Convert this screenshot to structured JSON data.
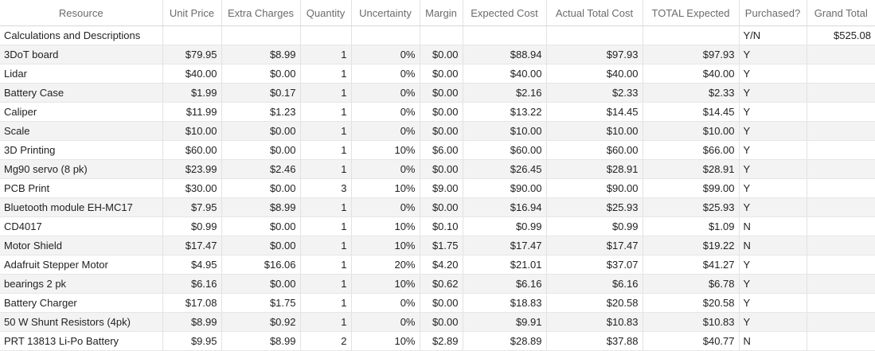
{
  "table": {
    "headers": [
      "Resource",
      "Unit Price",
      "Extra Charges",
      "Quantity",
      "Uncertainty",
      "Margin",
      "Expected Cost",
      "Actual Total Cost",
      "TOTAL Expected",
      "Purchased?",
      "Grand Total"
    ],
    "rows": [
      [
        "Calculations and Descriptions",
        "",
        "",
        "",
        "",
        "",
        "",
        "",
        "",
        "Y/N",
        "$525.08"
      ],
      [
        "3DoT board",
        "$79.95",
        "$8.99",
        "1",
        "0%",
        "$0.00",
        "$88.94",
        "$97.93",
        "$97.93",
        "Y",
        ""
      ],
      [
        "Lidar",
        "$40.00",
        "$0.00",
        "1",
        "0%",
        "$0.00",
        "$40.00",
        "$40.00",
        "$40.00",
        "Y",
        ""
      ],
      [
        "Battery Case",
        "$1.99",
        "$0.17",
        "1",
        "0%",
        "$0.00",
        "$2.16",
        "$2.33",
        "$2.33",
        "Y",
        ""
      ],
      [
        "Caliper",
        "$11.99",
        "$1.23",
        "1",
        "0%",
        "$0.00",
        "$13.22",
        "$14.45",
        "$14.45",
        "Y",
        ""
      ],
      [
        "Scale",
        "$10.00",
        "$0.00",
        "1",
        "0%",
        "$0.00",
        "$10.00",
        "$10.00",
        "$10.00",
        "Y",
        ""
      ],
      [
        "3D Printing",
        "$60.00",
        "$0.00",
        "1",
        "10%",
        "$6.00",
        "$60.00",
        "$60.00",
        "$66.00",
        "Y",
        ""
      ],
      [
        "Mg90 servo (8 pk)",
        "$23.99",
        "$2.46",
        "1",
        "0%",
        "$0.00",
        "$26.45",
        "$28.91",
        "$28.91",
        "Y",
        ""
      ],
      [
        "PCB Print",
        "$30.00",
        "$0.00",
        "3",
        "10%",
        "$9.00",
        "$90.00",
        "$90.00",
        "$99.00",
        "Y",
        ""
      ],
      [
        "Bluetooth module EH-MC17",
        "$7.95",
        "$8.99",
        "1",
        "0%",
        "$0.00",
        "$16.94",
        "$25.93",
        "$25.93",
        "Y",
        ""
      ],
      [
        "CD4017",
        "$0.99",
        "$0.00",
        "1",
        "10%",
        "$0.10",
        "$0.99",
        "$0.99",
        "$1.09",
        "N",
        ""
      ],
      [
        "Motor Shield",
        "$17.47",
        "$0.00",
        "1",
        "10%",
        "$1.75",
        "$17.47",
        "$17.47",
        "$19.22",
        "N",
        ""
      ],
      [
        "Adafruit Stepper Motor",
        "$4.95",
        "$16.06",
        "1",
        "20%",
        "$4.20",
        "$21.01",
        "$37.07",
        "$41.27",
        "Y",
        ""
      ],
      [
        "bearings 2 pk",
        "$6.16",
        "$0.00",
        "1",
        "10%",
        "$0.62",
        "$6.16",
        "$6.16",
        "$6.78",
        "Y",
        ""
      ],
      [
        "Battery Charger",
        "$17.08",
        "$1.75",
        "1",
        "0%",
        "$0.00",
        "$18.83",
        "$20.58",
        "$20.58",
        "Y",
        ""
      ],
      [
        "50 W Shunt Resistors (4pk)",
        "$8.99",
        "$0.92",
        "1",
        "0%",
        "$0.00",
        "$9.91",
        "$10.83",
        "$10.83",
        "Y",
        ""
      ],
      [
        "PRT 13813 Li-Po Battery",
        "$9.95",
        "$8.99",
        "2",
        "10%",
        "$2.89",
        "$28.89",
        "$37.88",
        "$40.77",
        "N",
        ""
      ]
    ]
  }
}
